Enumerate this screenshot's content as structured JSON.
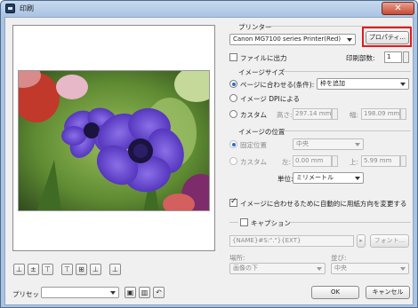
{
  "window": {
    "title": "印刷",
    "close_glyph": "✕"
  },
  "printer": {
    "group_label": "プリンター",
    "selected": "Canon MG7100 series Printer(Red)",
    "properties_button": "プロパティ...",
    "print_to_file_label": "ファイルに出力",
    "copies_label": "印刷部数:",
    "copies_value": "1"
  },
  "image_size": {
    "group_label": "イメージサイズ",
    "fit_page_label": "ページに合わせる(条件):",
    "fit_option": "枠を追加",
    "dpi_label": "イメージ DPIによる",
    "custom_label": "カスタム",
    "height_label": "高さ:",
    "height_value": "297.14 mm",
    "width_label": "幅:",
    "width_value": "198.09 mm"
  },
  "image_position": {
    "group_label": "イメージの位置",
    "fixed_label": "固定位置",
    "fixed_value": "中央",
    "custom_label": "カスタム",
    "left_label": "左:",
    "left_value": "0.00 mm",
    "top_label": "上:",
    "top_value": "5.99 mm",
    "unit_label": "単位:",
    "unit_value": "ミリメートル"
  },
  "auto_orient_label": "イメージに合わせるために自動的に用紙方向を変更する",
  "caption": {
    "group_label": "キャプション",
    "text": "{NAME}#S:\".\"}{EXT}",
    "font_button": "フォント...",
    "placement_label": "場所:",
    "placement_value": "画像の下",
    "align_label": "並び:",
    "align_value": "中央"
  },
  "footer": {
    "preset_label": "プリセット:",
    "preset_value": "",
    "ok_button": "OK",
    "cancel_button": "キャンセル"
  },
  "toolbar": [
    "⊥",
    "±",
    "⊤",
    "⊤",
    "⊞",
    "⊥",
    "⊥",
    "+"
  ]
}
